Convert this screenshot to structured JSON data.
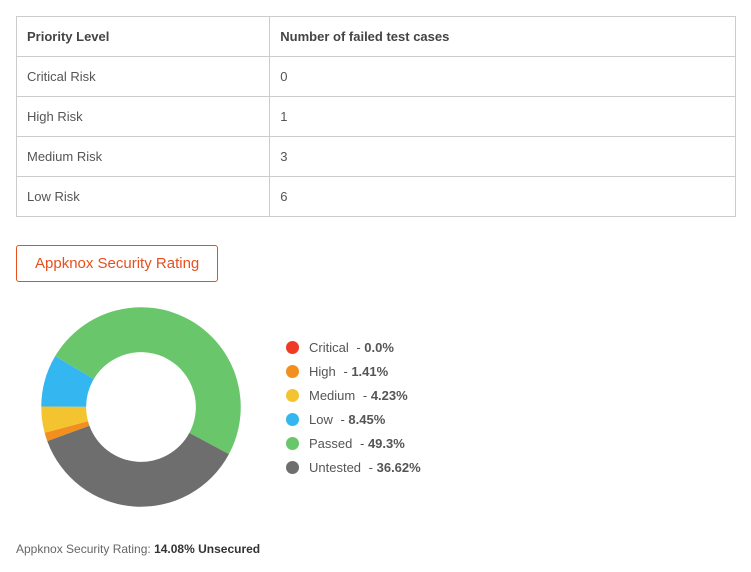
{
  "table": {
    "headers": [
      "Priority Level",
      "Number of failed test cases"
    ],
    "rows": [
      {
        "label": "Critical Risk",
        "value": "0"
      },
      {
        "label": "High Risk",
        "value": "1"
      },
      {
        "label": "Medium Risk",
        "value": "3"
      },
      {
        "label": "Low Risk",
        "value": "6"
      }
    ]
  },
  "rating_badge": "Appknox Security Rating",
  "legend_items": [
    {
      "name": "Critical",
      "percent": "0.0%",
      "color": "#ef3b24"
    },
    {
      "name": "High",
      "percent": "1.41%",
      "color": "#f28f1e"
    },
    {
      "name": "Medium",
      "percent": "4.23%",
      "color": "#f4c430"
    },
    {
      "name": "Low",
      "percent": "8.45%",
      "color": "#34b7f1"
    },
    {
      "name": "Passed",
      "percent": "49.3%",
      "color": "#6ac66a"
    },
    {
      "name": "Untested",
      "percent": "36.62%",
      "color": "#6e6e6e"
    }
  ],
  "footer": {
    "prefix": "Appknox Security Rating: ",
    "value": "14.08% Unsecured"
  },
  "chart_data": {
    "type": "pie",
    "title": "Appknox Security Rating",
    "series": [
      {
        "name": "Critical",
        "value": 0.0,
        "color": "#ef3b24"
      },
      {
        "name": "High",
        "value": 1.41,
        "color": "#f28f1e"
      },
      {
        "name": "Medium",
        "value": 4.23,
        "color": "#f4c430"
      },
      {
        "name": "Low",
        "value": 8.45,
        "color": "#34b7f1"
      },
      {
        "name": "Passed",
        "value": 49.3,
        "color": "#6ac66a"
      },
      {
        "name": "Untested",
        "value": 36.62,
        "color": "#6e6e6e"
      }
    ],
    "donut_inner_ratio": 0.55,
    "start_angle_deg": 160
  }
}
